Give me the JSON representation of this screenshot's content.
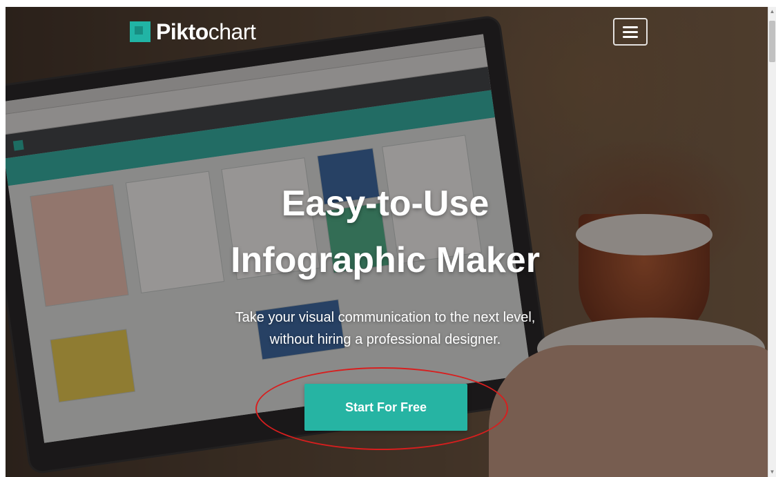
{
  "brand": {
    "name_bold": "Pikto",
    "name_light": "chart",
    "accent": "#26b4a3"
  },
  "nav": {
    "menu_icon": "hamburger-menu-icon"
  },
  "hero": {
    "headline_line1": "Easy-to-Use",
    "headline_line2": "Infographic Maker",
    "subtext_line1": "Take your visual communication to the next level,",
    "subtext_line2": "without hiring a professional designer.",
    "cta_label": "Start For Free",
    "highlight_color": "#d81e1e"
  },
  "scrollbar": {
    "up_icon": "▲",
    "down_icon": "▼"
  }
}
